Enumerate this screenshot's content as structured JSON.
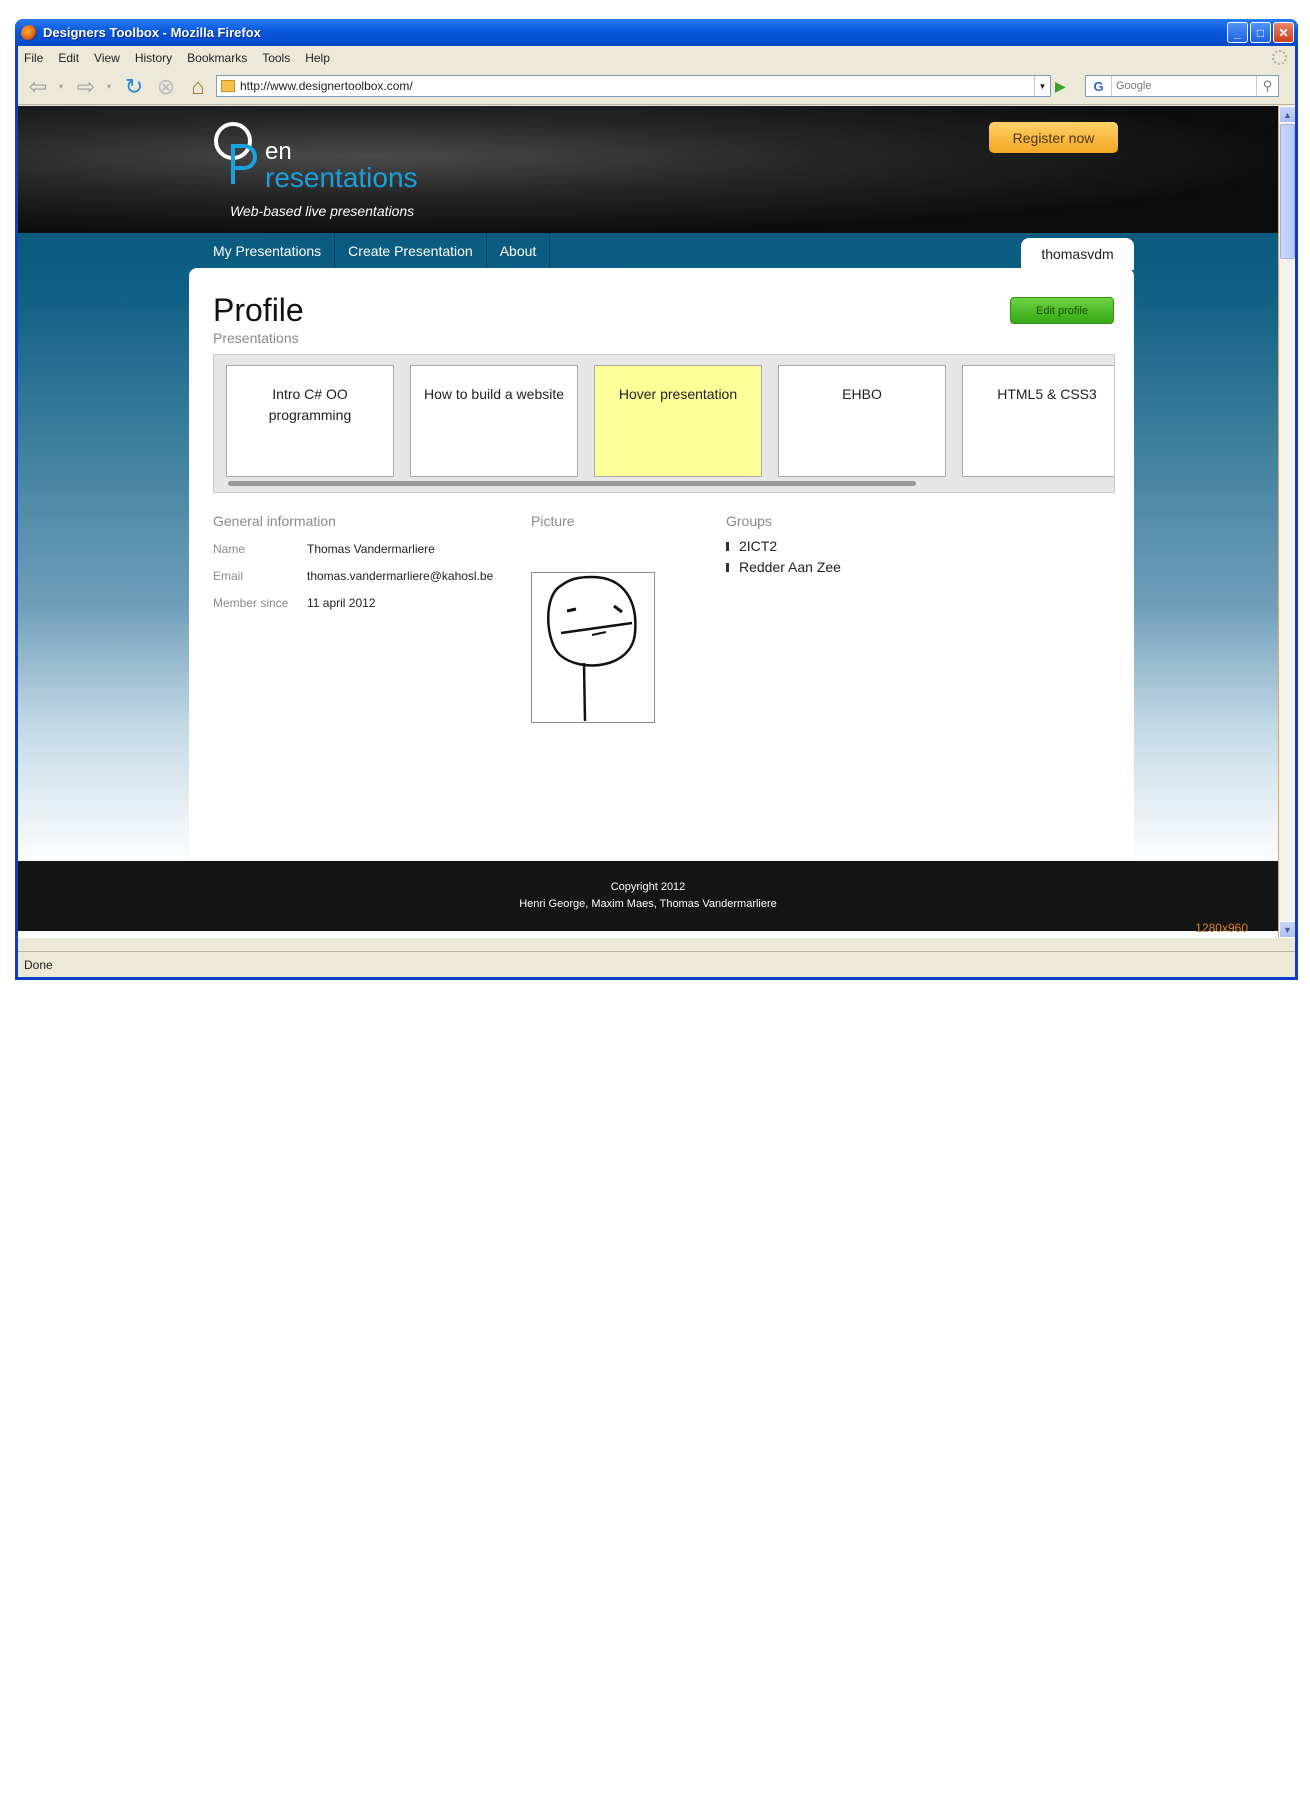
{
  "window": {
    "title": "Designers Toolbox  - Mozilla Firefox"
  },
  "menu": [
    "File",
    "Edit",
    "View",
    "History",
    "Bookmarks",
    "Tools",
    "Help"
  ],
  "navbar": {
    "url": "http://www.designertoolbox.com/",
    "search_placeholder": "Google"
  },
  "site": {
    "logo_en": "en",
    "logo_resentations": "resentations",
    "tagline": "Web-based live presentations",
    "register_label": "Register now",
    "nav": [
      "My Presentations",
      "Create Presentation",
      "About"
    ],
    "user_tab": "thomasvdm"
  },
  "profile": {
    "title": "Profile",
    "edit_label": "Edit profile",
    "presentations_label": "Presentations",
    "presentations": [
      {
        "title": "Intro C# OO programming",
        "highlighted": false
      },
      {
        "title": "How to build a website",
        "highlighted": false
      },
      {
        "title": "Hover presentation",
        "highlighted": true
      },
      {
        "title": "EHBO",
        "highlighted": false
      },
      {
        "title": "HTML5 & CSS3",
        "highlighted": false
      }
    ],
    "general_label": "General information",
    "info": [
      {
        "key": "Name",
        "value": "Thomas Vandermarliere"
      },
      {
        "key": "Email",
        "value": "thomas.vandermarliere@kahosl.be"
      },
      {
        "key": "Member since",
        "value": "11 april 2012"
      }
    ],
    "picture_label": "Picture",
    "groups_label": "Groups",
    "groups": [
      "2ICT2",
      "Redder Aan Zee"
    ]
  },
  "footer": {
    "copyright": "Copyright 2012",
    "authors": "Henri George, Maxim Maes, Thomas Vandermarliere"
  },
  "resolution_label": "1280x960",
  "status": "Done",
  "colors": {
    "accent_blue": "#1ba0e0",
    "register_orange": "#f5a623",
    "edit_green": "#36a815",
    "hover_yellow": "#ffff99"
  }
}
